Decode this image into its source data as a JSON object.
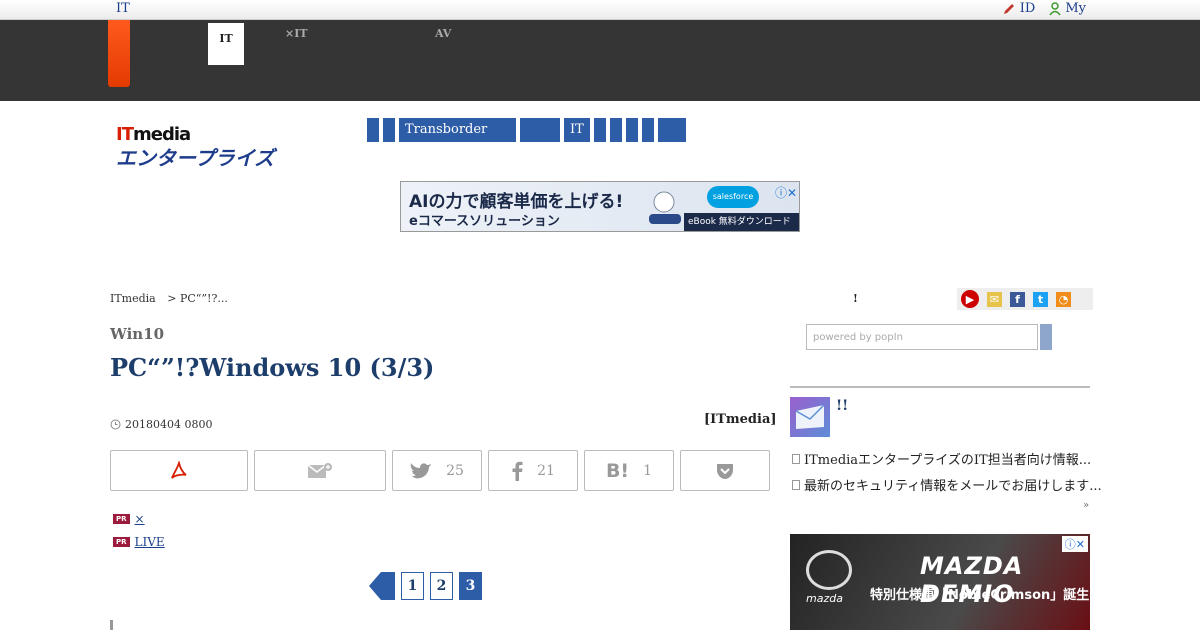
{
  "topbar": {
    "brand": "IT",
    "id_link": "ID",
    "my_link": "My"
  },
  "darknav": {
    "tabs": [
      {
        "line1": "",
        "line2": "IT"
      },
      {
        "line1": "",
        "line2": "×IT"
      },
      {
        "line1": "AV",
        "line2": ""
      }
    ]
  },
  "logo": {
    "line1_it": "IT",
    "line1_media": "media",
    "line2": "エンタープライズ"
  },
  "bluemenu": [
    "",
    "",
    "Transborder",
    "",
    "IT",
    "",
    "",
    "",
    "",
    ""
  ],
  "ad_banner": {
    "headline": "AIの力で顧客単価を上げる!",
    "sub": "eコマースソリューション",
    "brand": "salesforce",
    "cta": "eBook 無料ダウンロード"
  },
  "breadcrumb": [
    "ITmedia",
    "> PC“”!?..."
  ],
  "article": {
    "category": "Win10",
    "title": "PC“”!?Windows 10 (3/3)",
    "date": "20180404 0800",
    "byline": "[ITmedia]"
  },
  "share": {
    "twitter_count": "25",
    "facebook_count": "21",
    "hatena_label": "B!",
    "hatena_count": "1"
  },
  "pr_links": [
    {
      "badge": "PR",
      "text": "× "
    },
    {
      "badge": "PR",
      "text": "LIVE "
    }
  ],
  "pager": [
    "1",
    "2",
    "3"
  ],
  "right": {
    "mark": "!",
    "search_placeholder": "powered by popIn",
    "mail_heading": "!!",
    "links": [
      "ITmediaエンタープライズのIT担当者向け情報...",
      "最新のセキュリティ情報をメールでお届けします..."
    ],
    "more": "»"
  },
  "ad2": {
    "brand": "MAZDA DEMIO",
    "sub": "特別仕様車「NobleCrimson」誕生",
    "logo_text": "mazda"
  }
}
